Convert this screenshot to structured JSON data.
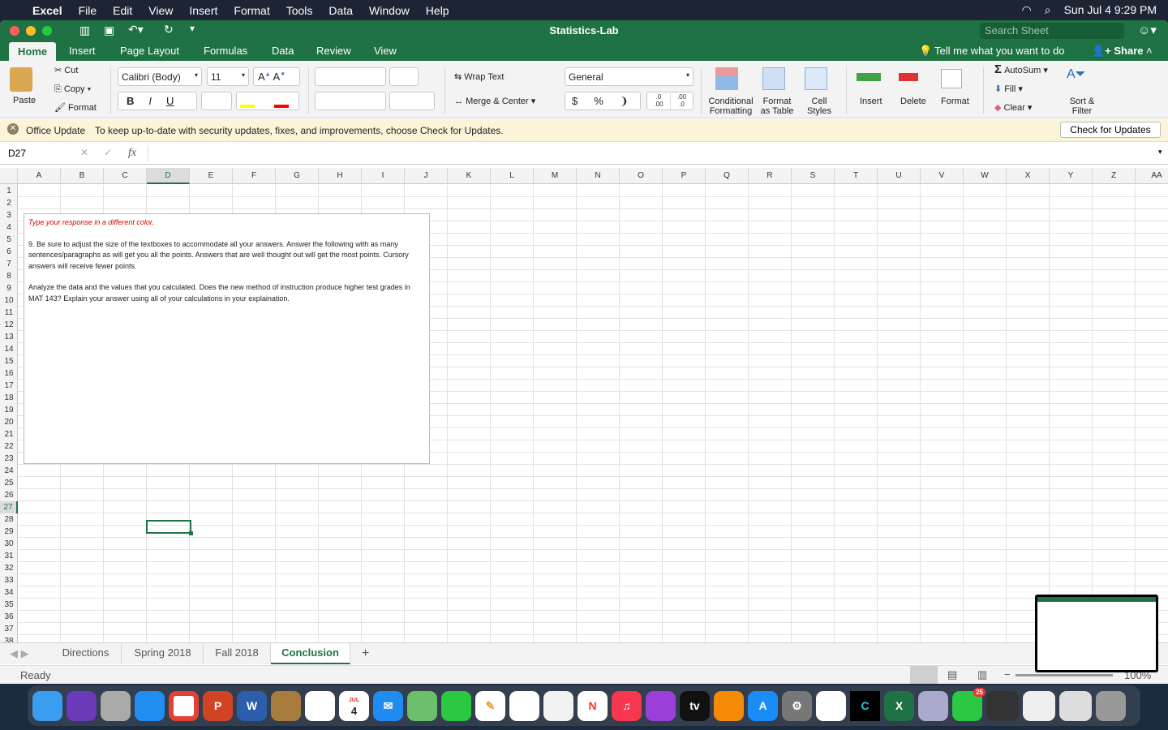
{
  "menubar": {
    "apple": "",
    "app": "Excel",
    "items": [
      "File",
      "Edit",
      "View",
      "Insert",
      "Format",
      "Tools",
      "Data",
      "Window",
      "Help"
    ],
    "clock": "Sun Jul 4  9:29 PM"
  },
  "window": {
    "title": "Statistics-Lab",
    "search_placeholder": "Search Sheet"
  },
  "ribbon_tabs": [
    "Home",
    "Insert",
    "Page Layout",
    "Formulas",
    "Data",
    "Review",
    "View"
  ],
  "tell_me": "Tell me what you want to do",
  "share": "Share",
  "ribbon": {
    "paste": "Paste",
    "cut": "Cut",
    "copy": "Copy",
    "format_painter": "Format",
    "font": "Calibri (Body)",
    "size": "11",
    "bold": "B",
    "italic": "I",
    "underline": "U",
    "wrap": "Wrap Text",
    "merge": "Merge & Center",
    "number_format": "General",
    "currency": "$",
    "percent": "%",
    "comma": "❩",
    "inc_dec": ".0\n.00",
    "dec_dec": ".00\n.0",
    "cond_fmt": "Conditional Formatting",
    "fmt_table": "Format as Table",
    "cell_styles": "Cell Styles",
    "insert": "Insert",
    "delete": "Delete",
    "format": "Format",
    "autosum": "AutoSum",
    "fill": "Fill",
    "clear": "Clear",
    "sort": "Sort & Filter"
  },
  "update": {
    "title": "Office Update",
    "message": "To keep up-to-date with security updates, fixes, and improvements, choose Check for Updates.",
    "button": "Check for Updates"
  },
  "formula_bar": {
    "name_box": "D27",
    "fx": "fx",
    "value": ""
  },
  "columns": [
    "A",
    "B",
    "C",
    "D",
    "E",
    "F",
    "G",
    "H",
    "I",
    "J",
    "K",
    "L",
    "M",
    "N",
    "O",
    "P",
    "Q",
    "R",
    "S",
    "T",
    "U",
    "V",
    "W",
    "X",
    "Y",
    "Z",
    "AA"
  ],
  "rows": [
    "1",
    "2",
    "3",
    "4",
    "5",
    "6",
    "7",
    "8",
    "9",
    "10",
    "11",
    "12",
    "13",
    "14",
    "15",
    "16",
    "17",
    "18",
    "19",
    "20",
    "21",
    "22",
    "23",
    "24",
    "25",
    "26",
    "27",
    "28",
    "29",
    "30",
    "31",
    "32",
    "33",
    "34",
    "35",
    "36",
    "37",
    "38"
  ],
  "selected_cell": "D27",
  "textbox": {
    "instruction": "Type your response in a different color.",
    "para1": "9.  Be sure to adjust the size of the textboxes to accommodate all your answers. Answer the following with as many sentences/paragraphs as will get you all the points. Answers that are well thought out will get the most points. Cursory answers will receive fewer points.",
    "para2": "Analyze the data and the values that you calculated. Does the new method of instruction produce higher test grades in MAT 143? Explain your answer using all of your calculations in your explaination."
  },
  "sheets": [
    "Directions",
    "Spring 2018",
    "Fall 2018",
    "Conclusion"
  ],
  "active_sheet": "Conclusion",
  "add_sheet": "+",
  "status": {
    "text": "Ready",
    "zoom": "100%"
  },
  "dock": {
    "calendar_month": "JUL",
    "calendar_day": "4",
    "messages_badge": "25",
    "appletv": "tv"
  },
  "colors": {
    "excel_green": "#1f7244",
    "instruction_red": "#e00000"
  }
}
